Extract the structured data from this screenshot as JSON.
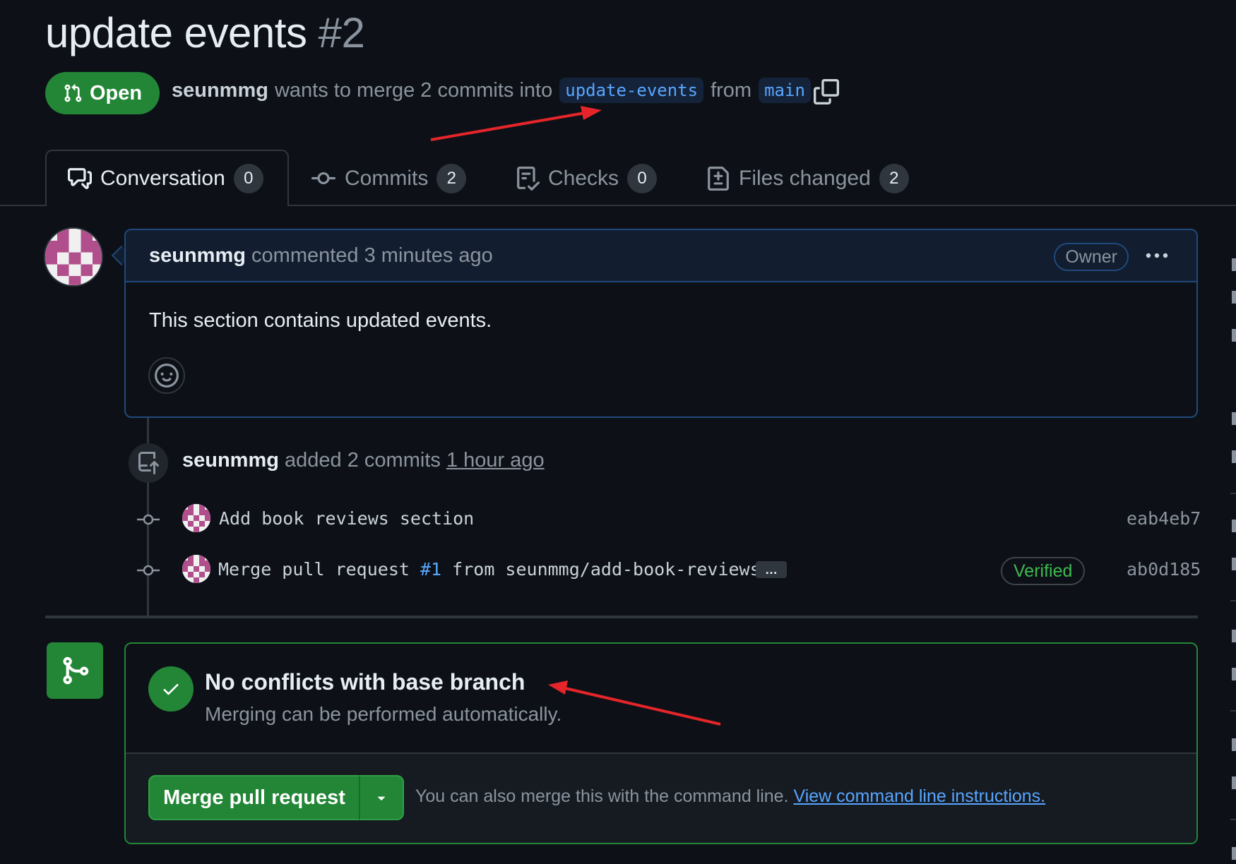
{
  "pr": {
    "title": "update events",
    "number": "#2",
    "state": "Open",
    "author": "seunmmg",
    "wants_text": "wants to merge 2 commits into",
    "base_branch": "update-events",
    "from_text": "from",
    "head_branch": "main"
  },
  "tabs": [
    {
      "label": "Conversation",
      "count": "0",
      "icon": "comment-discussion-icon",
      "active": true
    },
    {
      "label": "Commits",
      "count": "2",
      "icon": "git-commit-icon"
    },
    {
      "label": "Checks",
      "count": "0",
      "icon": "checklist-icon"
    },
    {
      "label": "Files changed",
      "count": "2",
      "icon": "file-diff-icon"
    }
  ],
  "comment": {
    "author": "seunmmg",
    "action": "commented 3 minutes ago",
    "badge": "Owner",
    "body": "This section contains updated events."
  },
  "push_event": {
    "author": "seunmmg",
    "action": "added 2 commits",
    "time": "1 hour ago"
  },
  "commits": [
    {
      "message": "Add book reviews section",
      "sha": "eab4eb7"
    },
    {
      "message_prefix": "Merge pull request",
      "ref": "#1",
      "message_suffix": "from seunmmg/add-book-reviews",
      "more": "…",
      "verified": "Verified",
      "sha": "ab0d185"
    }
  ],
  "merge": {
    "heading": "No conflicts with base branch",
    "subtext": "Merging can be performed automatically.",
    "button": "Merge pull request",
    "hint": "You can also merge this with the command line.",
    "hint_link": "View command line instructions."
  },
  "colors": {
    "background": "#0d1117",
    "success": "#238636",
    "link": "#58a6ff",
    "annotation": "#e5252a"
  }
}
